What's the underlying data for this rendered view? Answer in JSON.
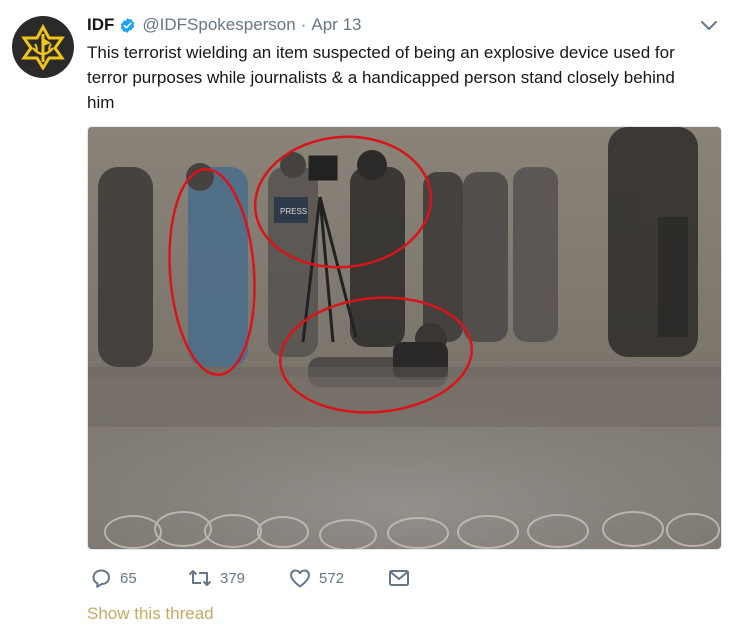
{
  "tweet": {
    "author_name": "IDF",
    "handle": "@IDFSpokesperson",
    "separator": "·",
    "date": "Apr 13",
    "text_lines": [
      "This terrorist wielding an item suspected of being an explosive device used for",
      "terror purposes while journalists & a handicapped person stand closely behind",
      "him"
    ],
    "media": {
      "annotation_color": "#d9141a",
      "press_vest_text": "PRESS"
    }
  },
  "icons": {
    "avatar": "idf-emblem-icon",
    "verified": "verified-badge-icon",
    "caret": "chevron-down-icon",
    "reply": "reply-icon",
    "retweet": "retweet-icon",
    "like": "heart-icon",
    "dm": "envelope-icon"
  },
  "actions": {
    "reply_count": "65",
    "retweet_count": "379",
    "like_count": "572"
  },
  "show_thread_label": "Show this thread",
  "colors": {
    "verified": "#1da1f2",
    "secondary_text": "#657786",
    "link": "#c8a964",
    "avatar_emblem": "#f0c419"
  }
}
